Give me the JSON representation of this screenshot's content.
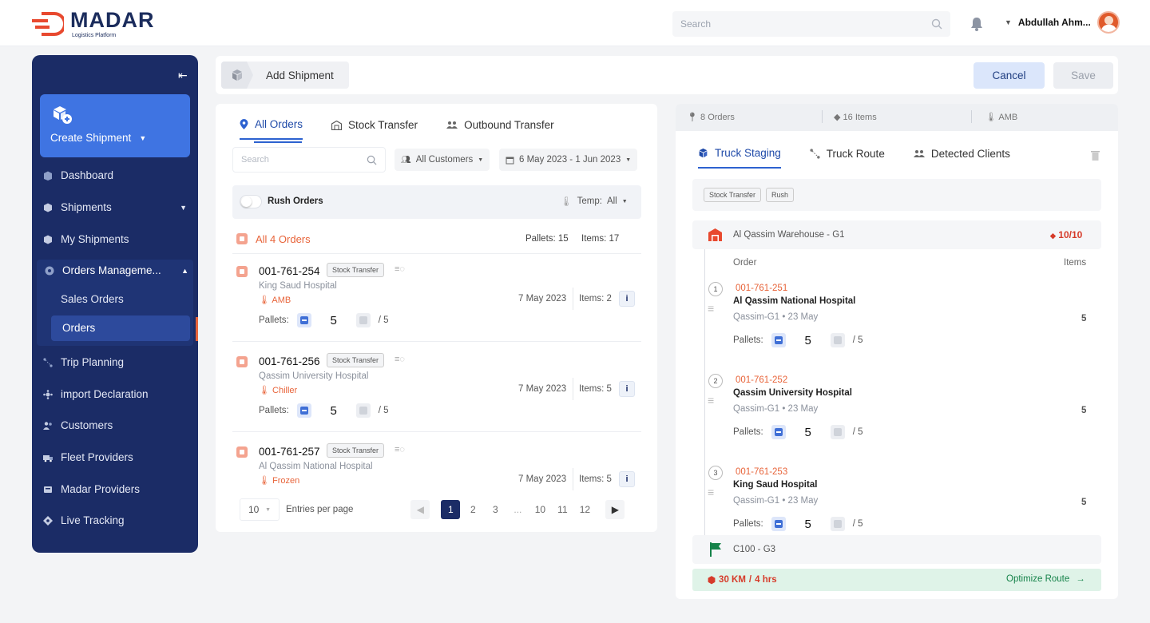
{
  "app": {
    "brand": "MADAR",
    "brand_sub": "Logistics Platform"
  },
  "topbar": {
    "search_placeholder": "Search",
    "user_name": "Abdullah Ahm..."
  },
  "sidebar": {
    "create_label": "Create Shipment",
    "items": [
      {
        "label": "Dashboard",
        "icon": "dashboard-icon"
      },
      {
        "label": "Shipments",
        "icon": "box-icon"
      },
      {
        "label": "My Shipments",
        "icon": "box-icon"
      },
      {
        "label": "Orders Manageme...",
        "icon": "orders-icon"
      },
      {
        "label": "Sales Orders"
      },
      {
        "label": "Orders"
      },
      {
        "label": "Trip Planning",
        "icon": "route-icon"
      },
      {
        "label": "import Declaration",
        "icon": "declaration-icon"
      },
      {
        "label": "Customers",
        "icon": "users-icon"
      },
      {
        "label": "Fleet Providers",
        "icon": "truck-icon"
      },
      {
        "label": "Madar Providers",
        "icon": "provider-icon"
      },
      {
        "label": "Live Tracking",
        "icon": "tracking-icon"
      }
    ]
  },
  "header": {
    "breadcrumb": "Add Shipment",
    "cancel": "Cancel",
    "save": "Save"
  },
  "left": {
    "tabs": [
      "All Orders",
      "Stock Transfer",
      "Outbound Transfer"
    ],
    "search_placeholder": "Search",
    "customers_filter": "All Customers",
    "date_filter": "6 May 2023 - 1 Jun 2023",
    "rush_label": "Rush Orders",
    "temp_label": "Temp:",
    "temp_value": "All",
    "all_orders_label": "All 4 Orders",
    "pallets_total": "Pallets: 15",
    "items_total": "Items: 17",
    "orders": [
      {
        "id": "001-761-254",
        "tag": "Stock Transfer",
        "client": "King Saud Hospital",
        "temp": "AMB",
        "date": "7 May 2023",
        "items": "Items: 2",
        "pallets_label": "Pallets:",
        "qty": "5",
        "max": "/ 5"
      },
      {
        "id": "001-761-256",
        "tag": "Stock Transfer",
        "client": "Qassim University Hospital",
        "temp": "Chiller",
        "date": "7 May 2023",
        "items": "Items: 5",
        "pallets_label": "Pallets:",
        "qty": "5",
        "max": "/ 5"
      },
      {
        "id": "001-761-257",
        "tag": "Stock Transfer",
        "client": "Al Qassim National Hospital",
        "temp": "Frozen",
        "date": "7 May 2023",
        "items": "Items: 5"
      }
    ],
    "pager": {
      "per_page": "10",
      "per_page_label": "Entries per page",
      "pages": [
        "1",
        "2",
        "3",
        "...",
        "10",
        "11",
        "12"
      ]
    }
  },
  "right": {
    "summary": {
      "orders": "8 Orders",
      "items": "16 Items",
      "temp": "AMB"
    },
    "tabs": [
      "Truck Staging",
      "Truck Route",
      "Detected Clients"
    ],
    "tags": [
      "Stock Transfer",
      "Rush"
    ],
    "warehouse": "Al Qassim Warehouse - G1",
    "capacity": "10/10",
    "col_order": "Order",
    "col_items": "Items",
    "stops": [
      {
        "n": "1",
        "id": "001-761-251",
        "client": "Al Qassim National Hospital",
        "meta": "Qassim-G1 • 23 May",
        "items": "5",
        "pallets_label": "Pallets:",
        "qty": "5",
        "max": "/ 5"
      },
      {
        "n": "2",
        "id": "001-761-252",
        "client": "Qassim University Hospital",
        "meta": "Qassim-G1 • 23 May",
        "items": "5",
        "pallets_label": "Pallets:",
        "qty": "5",
        "max": "/ 5"
      },
      {
        "n": "3",
        "id": "001-761-253",
        "client": "King Saud Hospital",
        "meta": "Qassim-G1 • 23 May",
        "items": "5",
        "pallets_label": "Pallets:",
        "qty": "5",
        "max": "/ 5"
      }
    ],
    "destination": "C100 - G3",
    "distance": "30 KM",
    "duration": "4 hrs",
    "optimize": "Optimize Route"
  }
}
